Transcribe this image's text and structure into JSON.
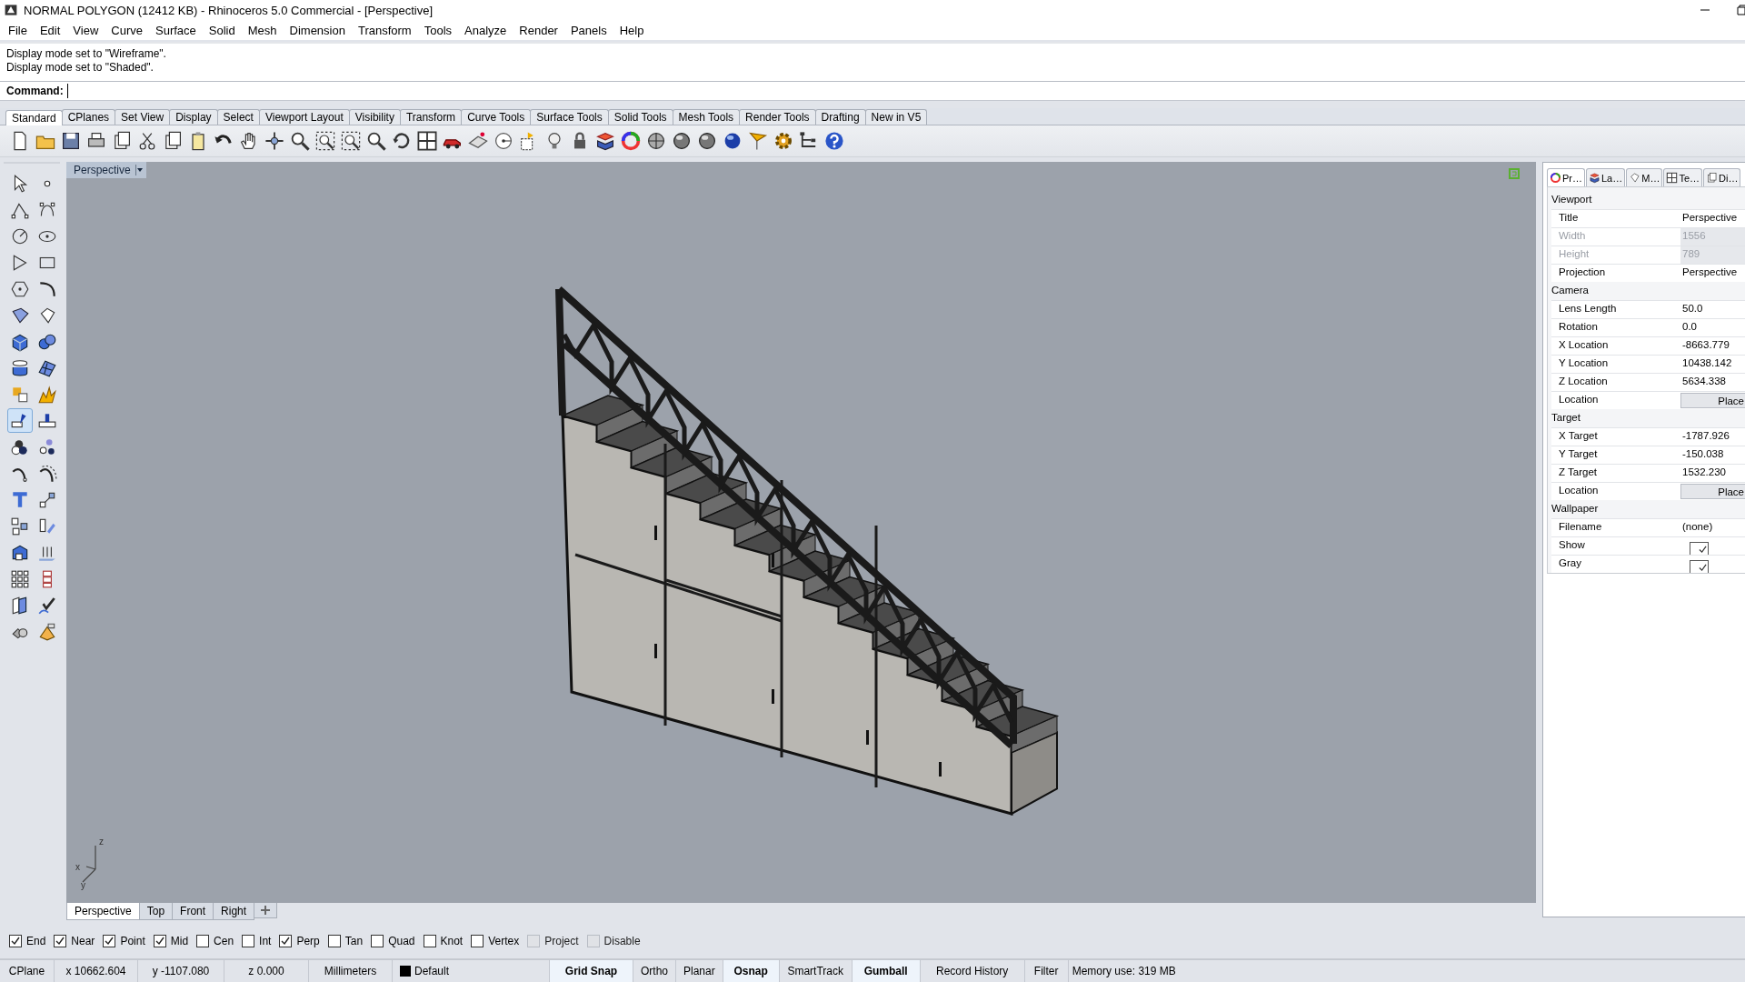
{
  "window": {
    "title": "NORMAL POLYGON (12412 KB) - Rhinoceros 5.0 Commercial - [Perspective]"
  },
  "menu": [
    "File",
    "Edit",
    "View",
    "Curve",
    "Surface",
    "Solid",
    "Mesh",
    "Dimension",
    "Transform",
    "Tools",
    "Analyze",
    "Render",
    "Panels",
    "Help"
  ],
  "command_history": [
    "Display mode set to \"Wireframe\".",
    "Display mode set to \"Shaded\"."
  ],
  "command": {
    "label": "Command:"
  },
  "toolbar_tabs": [
    {
      "label": "Standard",
      "selected": true
    },
    {
      "label": "CPlanes",
      "selected": false
    },
    {
      "label": "Set View",
      "selected": false
    },
    {
      "label": "Display",
      "selected": false
    },
    {
      "label": "Select",
      "selected": false
    },
    {
      "label": "Viewport Layout",
      "selected": false
    },
    {
      "label": "Visibility",
      "selected": false
    },
    {
      "label": "Transform",
      "selected": false
    },
    {
      "label": "Curve Tools",
      "selected": false
    },
    {
      "label": "Surface Tools",
      "selected": false
    },
    {
      "label": "Solid Tools",
      "selected": false
    },
    {
      "label": "Mesh Tools",
      "selected": false
    },
    {
      "label": "Render Tools",
      "selected": false
    },
    {
      "label": "Drafting",
      "selected": false
    },
    {
      "label": "New in V5",
      "selected": false
    }
  ],
  "left_toolbar": [
    {
      "selected": false
    },
    {
      "selected": false
    },
    {
      "selected": false
    },
    {
      "selected": false
    },
    {
      "selected": false
    },
    {
      "selected": false
    },
    {
      "selected": false
    },
    {
      "selected": false
    },
    {
      "selected": false
    },
    {
      "selected": false
    },
    {
      "selected": false
    },
    {
      "selected": false
    },
    {
      "selected": false
    },
    {
      "selected": false
    },
    {
      "selected": false
    },
    {
      "selected": false
    },
    {
      "selected": false
    },
    {
      "selected": false
    },
    {
      "selected": true
    },
    {
      "selected": false
    },
    {
      "selected": false
    },
    {
      "selected": false
    },
    {
      "selected": false
    },
    {
      "selected": false
    },
    {
      "selected": false
    },
    {
      "selected": false
    },
    {
      "selected": false
    },
    {
      "selected": false
    },
    {
      "selected": false
    },
    {
      "selected": false
    },
    {
      "selected": false
    },
    {
      "selected": false
    },
    {
      "selected": false
    },
    {
      "selected": false
    },
    {
      "selected": false
    },
    {
      "selected": false
    }
  ],
  "viewport": {
    "title": "Perspective",
    "axes": [
      "z",
      "x",
      "y"
    ]
  },
  "viewport_tabs": [
    {
      "label": "Perspective",
      "selected": true
    },
    {
      "label": "Top",
      "selected": false
    },
    {
      "label": "Front",
      "selected": false
    },
    {
      "label": "Right",
      "selected": false
    }
  ],
  "properties": {
    "tabs": [
      {
        "label": "Pr…",
        "selected": true
      },
      {
        "label": "La…",
        "selected": false
      },
      {
        "label": "M…",
        "selected": false
      },
      {
        "label": "Te…",
        "selected": false
      },
      {
        "label": "Di…",
        "selected": false
      }
    ],
    "sections": [
      {
        "title": "Viewport",
        "rows": [
          {
            "kind": "text",
            "label": "Title",
            "value": "Perspective"
          },
          {
            "kind": "readonly",
            "label": "Width",
            "value": "1556"
          },
          {
            "kind": "readonly",
            "label": "Height",
            "value": "789"
          },
          {
            "kind": "text",
            "label": "Projection",
            "value": "Perspective"
          }
        ]
      },
      {
        "title": "Camera",
        "rows": [
          {
            "kind": "text",
            "label": "Lens Length",
            "value": "50.0"
          },
          {
            "kind": "text",
            "label": "Rotation",
            "value": "0.0"
          },
          {
            "kind": "text",
            "label": "X Location",
            "value": "-8663.779"
          },
          {
            "kind": "text",
            "label": "Y Location",
            "value": "10438.142"
          },
          {
            "kind": "text",
            "label": "Z Location",
            "value": "5634.338"
          },
          {
            "kind": "button",
            "label": "Location",
            "value": "Place"
          }
        ]
      },
      {
        "title": "Target",
        "rows": [
          {
            "kind": "text",
            "label": "X Target",
            "value": "-1787.926"
          },
          {
            "kind": "text",
            "label": "Y Target",
            "value": "-150.038"
          },
          {
            "kind": "text",
            "label": "Z Target",
            "value": "1532.230"
          },
          {
            "kind": "button",
            "label": "Location",
            "value": "Place"
          }
        ]
      },
      {
        "title": "Wallpaper",
        "rows": [
          {
            "kind": "text",
            "label": "Filename",
            "value": "(none)"
          },
          {
            "kind": "checkbox",
            "label": "Show",
            "checked": true
          },
          {
            "kind": "checkbox",
            "label": "Gray",
            "checked": true
          }
        ]
      }
    ]
  },
  "osnaps": [
    {
      "label": "End",
      "checked": true,
      "disabled": false
    },
    {
      "label": "Near",
      "checked": true,
      "disabled": false
    },
    {
      "label": "Point",
      "checked": true,
      "disabled": false
    },
    {
      "label": "Mid",
      "checked": true,
      "disabled": false
    },
    {
      "label": "Cen",
      "checked": false,
      "disabled": false
    },
    {
      "label": "Int",
      "checked": false,
      "disabled": false
    },
    {
      "label": "Perp",
      "checked": true,
      "disabled": false
    },
    {
      "label": "Tan",
      "checked": false,
      "disabled": false
    },
    {
      "label": "Quad",
      "checked": false,
      "disabled": false
    },
    {
      "label": "Knot",
      "checked": false,
      "disabled": false
    },
    {
      "label": "Vertex",
      "checked": false,
      "disabled": false
    },
    {
      "label": "Project",
      "checked": false,
      "disabled": true
    },
    {
      "label": "Disable",
      "checked": false,
      "disabled": true
    }
  ],
  "status_bar": {
    "cells": [
      {
        "kind": "text",
        "text": "CPlane"
      },
      {
        "kind": "text",
        "text": "x 10662.604"
      },
      {
        "kind": "text",
        "text": "y -1107.080"
      },
      {
        "kind": "text",
        "text": "z 0.000"
      },
      {
        "kind": "text",
        "text": "Millimeters"
      },
      {
        "kind": "layer",
        "text": "Default",
        "color": "#000000"
      }
    ],
    "toggles": [
      {
        "label": "Grid Snap",
        "on": true
      },
      {
        "label": "Ortho",
        "on": false
      },
      {
        "label": "Planar",
        "on": false
      },
      {
        "label": "Osnap",
        "on": true
      },
      {
        "label": "SmartTrack",
        "on": false
      },
      {
        "label": "Gumball",
        "on": true
      },
      {
        "label": "Record History",
        "on": false
      },
      {
        "label": "Filter",
        "on": false
      }
    ],
    "memory": "Memory use: 319 MB"
  }
}
